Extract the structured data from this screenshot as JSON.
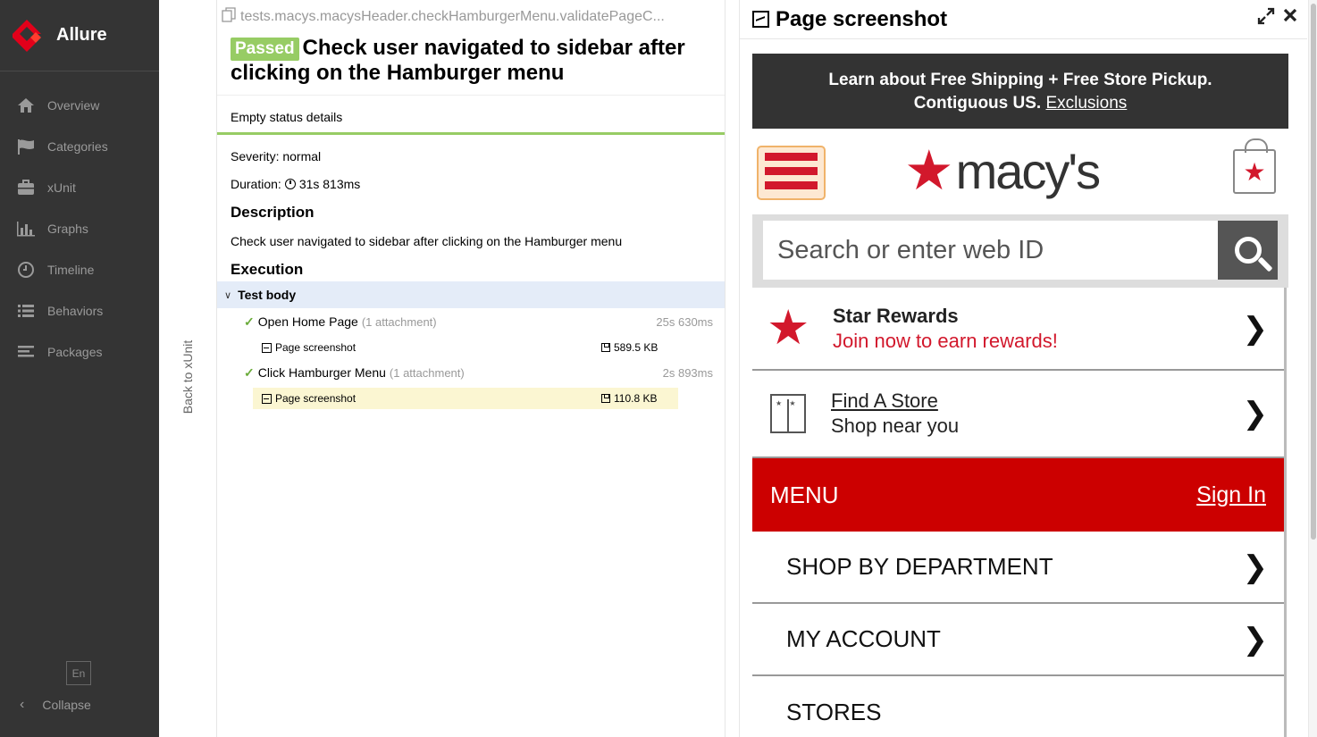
{
  "sidebar": {
    "brand": "Allure",
    "items": [
      {
        "label": "Overview",
        "icon": "home-icon"
      },
      {
        "label": "Categories",
        "icon": "flag-icon"
      },
      {
        "label": "xUnit",
        "icon": "briefcase-icon"
      },
      {
        "label": "Graphs",
        "icon": "bar-chart-icon"
      },
      {
        "label": "Timeline",
        "icon": "clock-icon"
      },
      {
        "label": "Behaviors",
        "icon": "list-icon"
      },
      {
        "label": "Packages",
        "icon": "align-left-icon"
      }
    ],
    "language": "En",
    "collapse": "Collapse"
  },
  "back": "Back to xUnit",
  "test": {
    "path": "tests.macys.macysHeader.checkHamburgerMenu.validatePageC...",
    "status": "Passed",
    "title": "Check user navigated to sidebar after clicking on the Hamburger menu",
    "status_details": "Empty status details",
    "severity": "Severity: normal",
    "duration_label": "Duration:",
    "duration": "31s 813ms",
    "description_heading": "Description",
    "description": "Check user navigated to sidebar after clicking on the Hamburger menu",
    "execution_heading": "Execution",
    "test_body": "Test body",
    "steps": [
      {
        "name": "Open Home Page",
        "attachments": "(1 attachment)",
        "time": "25s 630ms",
        "attachment": {
          "name": "Page screenshot",
          "size": "589.5 KB"
        }
      },
      {
        "name": "Click Hamburger Menu",
        "attachments": "(1 attachment)",
        "time": "2s 893ms",
        "attachment": {
          "name": "Page screenshot",
          "size": "110.8 KB"
        }
      }
    ]
  },
  "viewer": {
    "title": "Page screenshot",
    "shot": {
      "ship_line1": "Learn about Free Shipping + Free Store Pickup.",
      "ship_line2": "Contiguous US.",
      "ship_link": "Exclusions",
      "logo_text": "macy's",
      "search_placeholder": "Search or enter web ID",
      "rewards_title": "Star Rewards",
      "rewards_sub": "Join now to earn rewards!",
      "store_title": "Find A Store",
      "store_sub": "Shop near you",
      "menu_label": "MENU",
      "sign_in": "Sign In",
      "menu_items": [
        "SHOP BY DEPARTMENT",
        "MY ACCOUNT",
        "STORES"
      ]
    }
  },
  "colors": {
    "sidebar_bg": "#343434",
    "passed": "#97cc64",
    "macys_red": "#cc0000",
    "selected_row": "#fbf6d2",
    "test_body_bg": "#e4ecf8"
  }
}
